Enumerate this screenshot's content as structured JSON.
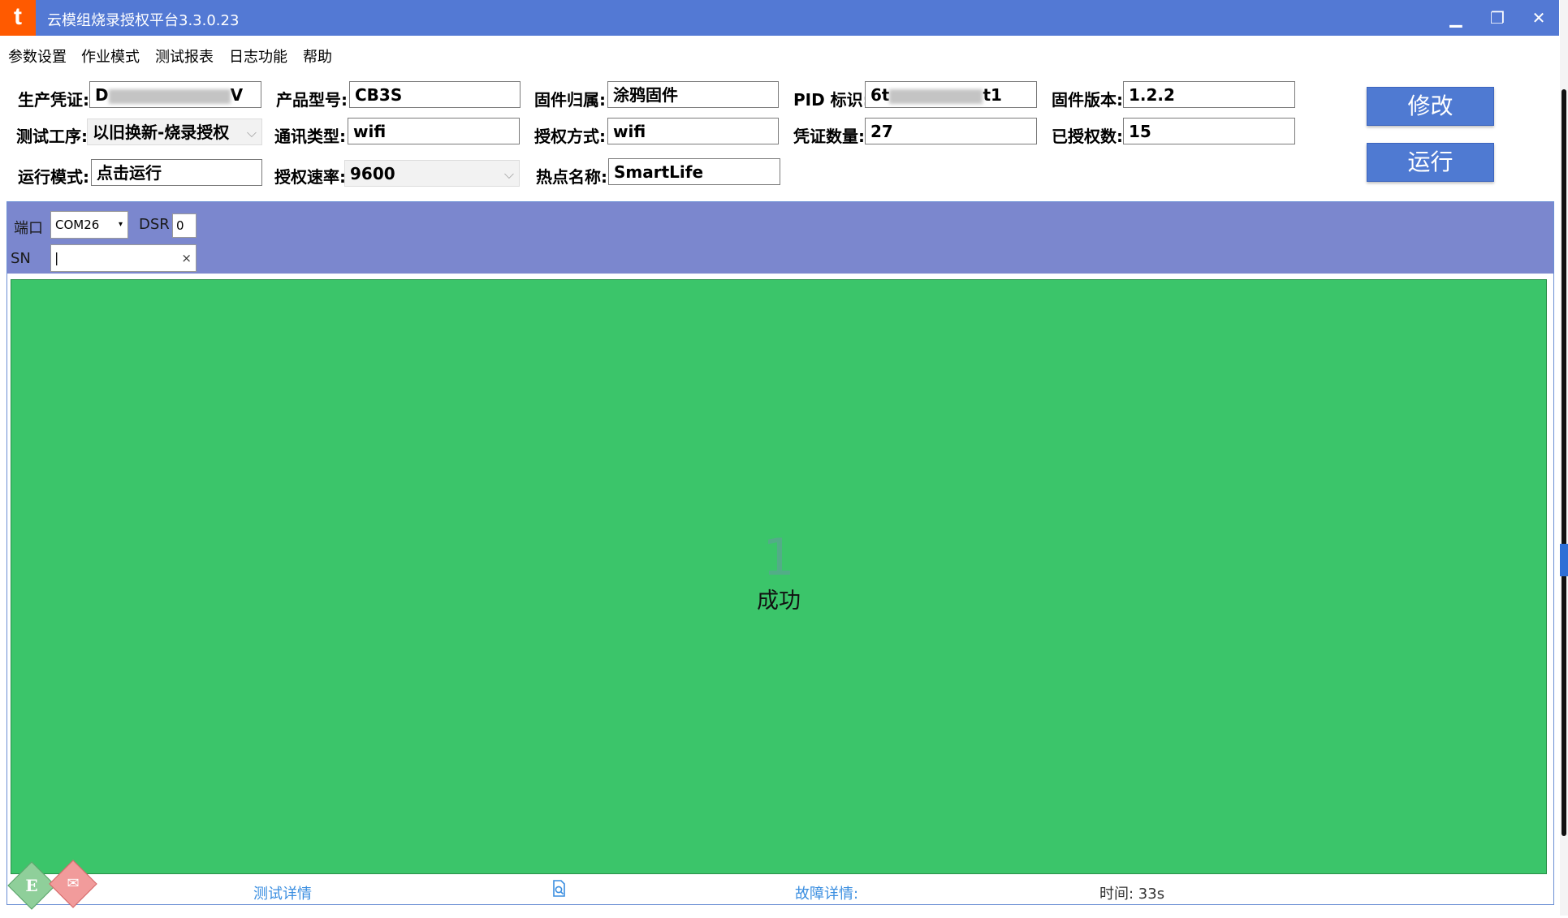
{
  "window": {
    "title": "云模组烧录授权平台3.3.0.23",
    "logo_glyph": "t",
    "controls": {
      "minimize": "▁",
      "restore": "❐",
      "close": "✕"
    }
  },
  "menu": [
    "参数设置",
    "作业模式",
    "测试报表",
    "日志功能",
    "帮助"
  ],
  "form": {
    "credential": {
      "label": "生产凭证:",
      "value_start": "D",
      "value_end": "V"
    },
    "product_model": {
      "label": "产品型号:",
      "value": "CB3S"
    },
    "firmware_owner": {
      "label": "固件归属:",
      "value": "涂鸦固件"
    },
    "pid": {
      "label": "PID 标识:",
      "value_start": "6t",
      "value_end": "t1"
    },
    "firmware_version": {
      "label": "固件版本:",
      "value": "1.2.2"
    },
    "test_process": {
      "label": "测试工序:",
      "value": "以旧换新-烧录授权"
    },
    "comm_type": {
      "label": "通讯类型:",
      "value": "wifi"
    },
    "auth_method": {
      "label": "授权方式:",
      "value": "wifi"
    },
    "credential_count": {
      "label": "凭证数量:",
      "value": "27"
    },
    "authorized_count": {
      "label": "已授权数:",
      "value": "15"
    },
    "run_mode": {
      "label": "运行模式:",
      "value": "点击运行"
    },
    "auth_rate": {
      "label": "授权速率:",
      "value": "9600"
    },
    "hotspot_name": {
      "label": "热点名称:",
      "value": "SmartLife"
    }
  },
  "buttons": {
    "modify": "修改",
    "run": "运行"
  },
  "station": {
    "port_label": "端口",
    "port_value": "COM26",
    "dsr_label": "DSR",
    "dsr_value": "0",
    "sn_label": "SN",
    "sn_value": "|",
    "sn_clear": "×",
    "result_count": "1",
    "result_status": "成功",
    "footer": {
      "test_details": "测试详情",
      "fault_details": "故障详情:",
      "time": "时间: 33s"
    },
    "badges": {
      "e": "E",
      "r": "✉"
    }
  },
  "colors": {
    "titlebar": "#5379d4",
    "station_bar": "#7b87ce",
    "success_green": "#3bc56a",
    "button_blue": "#4f7ad2",
    "logo_orange": "#ff5a00"
  },
  "icons": {
    "log_search": "document-search-icon",
    "dropdown": "chevron-down-icon"
  }
}
